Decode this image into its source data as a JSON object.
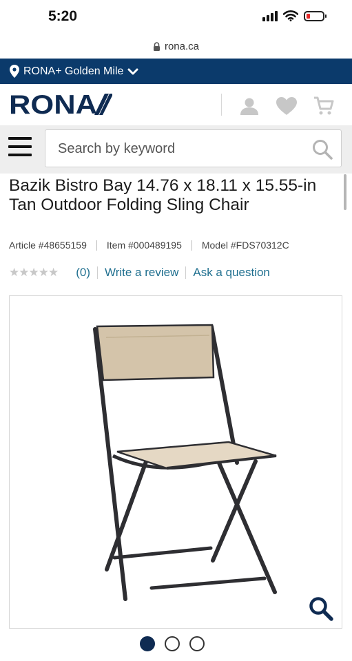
{
  "status_bar": {
    "time": "5:20"
  },
  "browser": {
    "url": "rona.ca"
  },
  "store": {
    "label": "RONA+ Golden Mile"
  },
  "header": {
    "logo_text": "RONA"
  },
  "search": {
    "placeholder": "Search by keyword"
  },
  "product": {
    "title": "Bazik Bistro Bay 14.76 x 18.11 x 15.55-in Tan Outdoor Folding Sling Chair",
    "article": "Article #48655159",
    "item": "Item #000489195",
    "model": "Model #FDS70312C",
    "stars": "★★★★★",
    "review_count": "(0)",
    "write_review": "Write a review",
    "ask_question": "Ask a question"
  },
  "gallery": {
    "slide_count": 3,
    "active_slide": 1
  },
  "colors": {
    "store_bar": "#0b3a6b",
    "brand_navy": "#0f2b52",
    "link": "#1f6f8f",
    "chair_fabric": "#d4c4aa"
  },
  "icons": [
    "lock-icon",
    "location-pin-icon",
    "chevron-down-icon",
    "account-icon",
    "heart-icon",
    "cart-icon",
    "menu-icon",
    "search-icon",
    "zoom-icon"
  ]
}
